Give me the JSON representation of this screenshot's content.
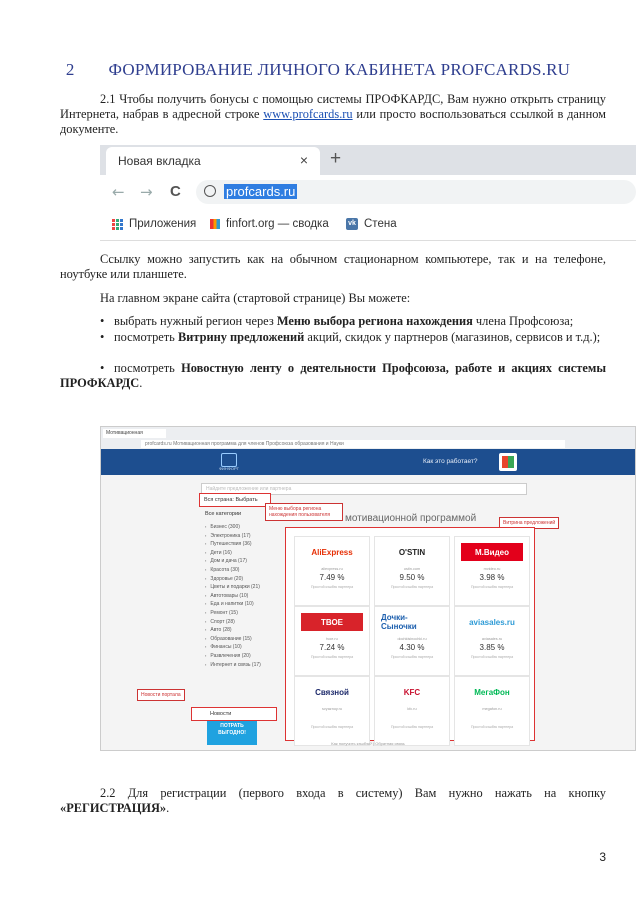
{
  "section": {
    "number": "2",
    "title": "ФОРМИРОВАНИЕ ЛИЧНОГО КАБИНЕТА PROFCARDS.RU"
  },
  "para_2_1": {
    "text_before": "2.1 Чтобы получить бонусы с помощью системы ПРОФКАРДС, Вам нужно открыть страницу Интернета, набрав в адресной строке ",
    "link": "www.profcards.ru",
    "text_after": " или просто воспользоваться ссылкой в данном документе."
  },
  "browser": {
    "tab_title": "Новая вкладка",
    "tab_close": "×",
    "new_tab": "+",
    "back": "←",
    "forward": "→",
    "reload": "C",
    "url": "profcards.ru",
    "bookmarks": [
      "Приложения",
      "finfort.org — сводка",
      "Стена"
    ]
  },
  "para_link": "Ссылку можно запустить как на обычном стационарном компьютере, так и на телефоне, ноутбуке или планшете.",
  "para_main": "На главном экране сайта (стартовой странице) Вы можете:",
  "bullets": [
    {
      "pre": "выбрать нужный регион через ",
      "bold": "Меню выбора региона нахождения",
      "post": " члена Профсоюза;"
    },
    {
      "pre": "посмотреть ",
      "bold": "Витрину предложений",
      "post": " акций, скидок у партнеров (магазинов, сервисов и т.д.);"
    },
    {
      "pre": "посмотреть ",
      "bold": "Новостную ленту о деятельности Профсоюза, работе и акциях системы ПРОФКАРДС",
      "post": "."
    }
  ],
  "site": {
    "tab_label": "Мотивационная",
    "address": "profcards.ru   Мотивационная программа для членов Профсоюза образования и Науки",
    "logo_text": "ФИНФОРТ",
    "header_question": "Как это работает?",
    "search_placeholder": "Найдите предложение или партнера",
    "region_button": "Вся страна: Выбрать",
    "region_callout": "Меню выбора региона нахождения пользователя",
    "section_title": "мотивационной программой",
    "showcase_callout": "Витрина предложений",
    "categories_header": "Все категории",
    "categories": [
      "Бизнес (300)",
      "Электроника (17)",
      "Путешествия (36)",
      "Дети (16)",
      "Дом и дача (17)",
      "Красота (30)",
      "Здоровье (20)",
      "Цветы и подарки (21)",
      "Автотовары (10)",
      "Еда и напитки (10)",
      "Ремонт (15)",
      "Спорт (28)",
      "Авто (28)",
      "Образование (15)",
      "Финансы (10)",
      "Развлечения (20)",
      "Интернет и связь (17)"
    ],
    "news_callout": "Новости портала",
    "news_label": "Новости",
    "promo_text": "ПОТРАТЬ ВЫГОДНО!",
    "footer_text": "Как получить кэшбэк?  |  Обратная связь",
    "partners": [
      {
        "name": "AliExpress",
        "domain": "aliexpress.ru",
        "pct": "7.49 %",
        "color": "#e62e04"
      },
      {
        "name": "O'STIN",
        "domain": "ostin.com",
        "pct": "9.50 %",
        "color": "#222222"
      },
      {
        "name": "М.Видео",
        "domain": "mvideo.ru",
        "pct": "3.98 %",
        "color": "#e3001b"
      },
      {
        "name": "ТВОЕ",
        "domain": "tvoe.ru",
        "pct": "7.24 %",
        "color": "#d8232a"
      },
      {
        "name": "Дочки-Сыночки",
        "domain": "dochkisinochki.ru",
        "pct": "4.30 %",
        "color": "#1c5fae"
      },
      {
        "name": "aviasales.ru",
        "domain": "aviasales.ru",
        "pct": "3.85 %",
        "color": "#2e9bd6"
      },
      {
        "name": "Связной",
        "domain": "svyaznoy.ru",
        "pct": "",
        "color": "#1d2a6b"
      },
      {
        "name": "KFC",
        "domain": "kfc.ru",
        "pct": "",
        "color": "#c8102e"
      },
      {
        "name": "МегаФон",
        "domain": "megafon.ru",
        "pct": "",
        "color": "#00b956"
      }
    ],
    "card_small": "Простой кэшбэк партнера"
  },
  "para_2_2": {
    "text": "2.2 Для регистрации (первого входа в систему) Вам нужно нажать на кнопку ",
    "bold": "«РЕГИСТРАЦИЯ»",
    "end": "."
  },
  "page_number": "3"
}
